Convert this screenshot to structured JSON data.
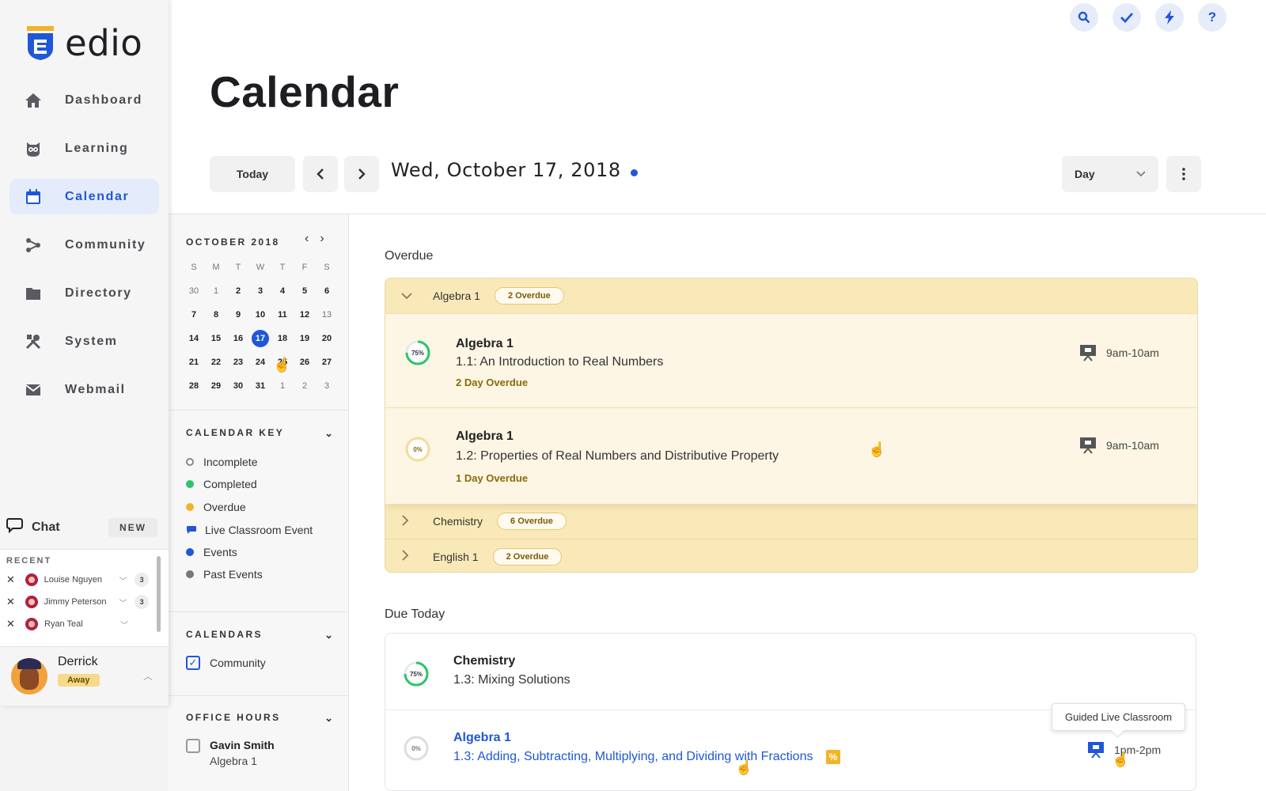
{
  "app": {
    "logo_text": "edio",
    "brand_color": "#2057d6"
  },
  "nav": {
    "items": [
      {
        "label": "Dashboard",
        "icon": "home-icon"
      },
      {
        "label": "Learning",
        "icon": "owl-icon"
      },
      {
        "label": "Calendar",
        "icon": "calendar-icon",
        "active": true
      },
      {
        "label": "Community",
        "icon": "community-icon"
      },
      {
        "label": "Directory",
        "icon": "folder-icon"
      },
      {
        "label": "System",
        "icon": "tools-icon"
      },
      {
        "label": "Webmail",
        "icon": "mail-icon"
      }
    ]
  },
  "chat": {
    "label": "Chat",
    "new_button": "NEW",
    "recent_label": "RECENT",
    "recent": [
      {
        "name": "Louise Nguyen",
        "count": "3"
      },
      {
        "name": "Jimmy Peterson",
        "count": "3"
      },
      {
        "name": "Ryan Teal",
        "count": ""
      }
    ],
    "me": {
      "name": "Derrick",
      "status": "Away"
    }
  },
  "header": {
    "title": "Calendar",
    "top_icons": [
      "search-icon",
      "check-icon",
      "lightning-icon",
      "help-icon"
    ],
    "today_button": "Today",
    "date": "Wed, October 17, 2018",
    "view_select": "Day"
  },
  "mini_calendar": {
    "month": "OCTOBER 2018",
    "weekdays": [
      "S",
      "M",
      "T",
      "W",
      "T",
      "F",
      "S"
    ],
    "weeks": [
      [
        "30",
        "1",
        "2",
        "3",
        "4",
        "5",
        "6"
      ],
      [
        "7",
        "8",
        "9",
        "10",
        "11",
        "12",
        "13"
      ],
      [
        "14",
        "15",
        "16",
        "17",
        "18",
        "19",
        "20"
      ],
      [
        "21",
        "22",
        "23",
        "24",
        "25",
        "26",
        "27"
      ],
      [
        "28",
        "29",
        "30",
        "31",
        "1",
        "2",
        "3"
      ]
    ],
    "selected": "17"
  },
  "calendar_key": {
    "title": "CALENDAR KEY",
    "items": [
      {
        "label": "Incomplete",
        "color": "#ffffff"
      },
      {
        "label": "Completed",
        "color": "#2ec36a"
      },
      {
        "label": "Overdue",
        "color": "#f3b325"
      },
      {
        "label": "Live Classroom Event",
        "color": "#2057d6"
      },
      {
        "label": "Events",
        "color": "#2057d6"
      },
      {
        "label": "Past Events",
        "color": "#777777"
      }
    ]
  },
  "calendars": {
    "title": "CALENDARS",
    "items": [
      {
        "label": "Community",
        "checked": true
      }
    ]
  },
  "office_hours": {
    "title": "OFFICE HOURS",
    "items": [
      {
        "name": "Gavin Smith",
        "subject": "Algebra 1",
        "checked": false
      }
    ]
  },
  "overdue": {
    "title": "Overdue",
    "groups": [
      {
        "subject": "Algebra 1",
        "badge": "2 Overdue",
        "expanded": true
      },
      {
        "subject": "Chemistry",
        "badge": "6 Overdue",
        "expanded": false
      },
      {
        "subject": "English 1",
        "badge": "2 Overdue",
        "expanded": false
      }
    ],
    "cards": [
      {
        "progress": 75,
        "progress_label": "75%",
        "subject": "Algebra 1",
        "lesson": "1.1: An Introduction to Real Numbers",
        "due": "2 Day Overdue",
        "time": "9am-10am"
      },
      {
        "progress": 0,
        "progress_label": "0%",
        "subject": "Algebra 1",
        "lesson": "1.2: Properties of Real Numbers and Distributive Property",
        "due": "1 Day Overdue",
        "time": "9am-10am"
      }
    ]
  },
  "due_today": {
    "title": "Due Today",
    "cards": [
      {
        "progress": 75,
        "progress_label": "75%",
        "subject": "Chemistry",
        "lesson": "1.3: Mixing Solutions",
        "time": ""
      },
      {
        "progress": 0,
        "progress_label": "0%",
        "subject": "Algebra 1",
        "lesson": "1.3: Adding, Subtracting, Multiplying, and Dividing with Fractions",
        "time": "1pm-2pm"
      }
    ]
  },
  "tooltip": "Guided Live Classroom"
}
